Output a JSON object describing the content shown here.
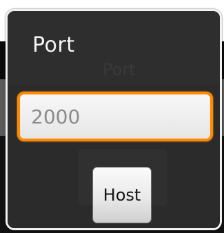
{
  "dialog": {
    "title": "Port",
    "background_title_ghost": "Port",
    "port_field": {
      "value": "2000",
      "placeholder": ""
    },
    "host_button_label": "Host"
  },
  "colors": {
    "dialog_background": "#2c2c2c",
    "focus_accent": "#ff8a00",
    "dialog_border": "#f2f2f2"
  }
}
